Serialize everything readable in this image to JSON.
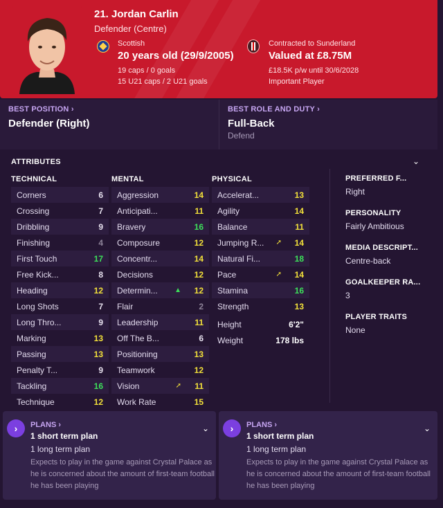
{
  "header": {
    "name": "21. Jordan Carlin",
    "position": "Defender (Centre)",
    "nationality": "Scottish",
    "age": "20 years old (29/9/2005)",
    "caps": "19 caps / 0 goals",
    "u21_caps": "15 U21 caps / 2 U21 goals",
    "contract": "Contracted to Sunderland",
    "value": "Valued at £8.75M",
    "wage": "£18.5K p/w until 30/6/2028",
    "importance": "Important Player",
    "colors": {
      "accent": "#c8192c"
    }
  },
  "best_position": {
    "title": "BEST POSITION",
    "value": "Defender (Right)"
  },
  "best_role": {
    "title": "BEST ROLE AND DUTY",
    "value": "Full-Back",
    "duty": "Defend"
  },
  "attributes": {
    "title": "ATTRIBUTES",
    "technical_title": "TECHNICAL",
    "mental_title": "MENTAL",
    "physical_title": "PHYSICAL",
    "technical": [
      {
        "name": "Corners",
        "value": "6"
      },
      {
        "name": "Crossing",
        "value": "7"
      },
      {
        "name": "Dribbling",
        "value": "9"
      },
      {
        "name": "Finishing",
        "value": "4"
      },
      {
        "name": "First Touch",
        "value": "17"
      },
      {
        "name": "Free Kick...",
        "value": "8"
      },
      {
        "name": "Heading",
        "value": "12"
      },
      {
        "name": "Long Shots",
        "value": "7"
      },
      {
        "name": "Long Thro...",
        "value": "9"
      },
      {
        "name": "Marking",
        "value": "13"
      },
      {
        "name": "Passing",
        "value": "13"
      },
      {
        "name": "Penalty T...",
        "value": "9"
      },
      {
        "name": "Tackling",
        "value": "16"
      },
      {
        "name": "Technique",
        "value": "12"
      }
    ],
    "mental": [
      {
        "name": "Aggression",
        "value": "14"
      },
      {
        "name": "Anticipati...",
        "value": "11"
      },
      {
        "name": "Bravery",
        "value": "16"
      },
      {
        "name": "Composure",
        "value": "12"
      },
      {
        "name": "Concentr...",
        "value": "14"
      },
      {
        "name": "Decisions",
        "value": "12"
      },
      {
        "name": "Determin...",
        "value": "12"
      },
      {
        "name": "Flair",
        "value": "2"
      },
      {
        "name": "Leadership",
        "value": "11"
      },
      {
        "name": "Off The B...",
        "value": "6"
      },
      {
        "name": "Positioning",
        "value": "13"
      },
      {
        "name": "Teamwork",
        "value": "12"
      },
      {
        "name": "Vision",
        "value": "11"
      },
      {
        "name": "Work Rate",
        "value": "15"
      }
    ],
    "physical": [
      {
        "name": "Accelerat...",
        "value": "13"
      },
      {
        "name": "Agility",
        "value": "14"
      },
      {
        "name": "Balance",
        "value": "11"
      },
      {
        "name": "Jumping R...",
        "value": "14"
      },
      {
        "name": "Natural Fi...",
        "value": "18"
      },
      {
        "name": "Pace",
        "value": "14"
      },
      {
        "name": "Stamina",
        "value": "16"
      },
      {
        "name": "Strength",
        "value": "13"
      }
    ],
    "height_label": "Height",
    "height": "6'2\"",
    "weight_label": "Weight",
    "weight": "178 lbs"
  },
  "side": {
    "preferred_foot_title": "PREFERRED F...",
    "preferred_foot": "Right",
    "personality_title": "PERSONALITY",
    "personality": "Fairly Ambitious",
    "media_title": "MEDIA DESCRIPT...",
    "media": "Centre-back",
    "gk_title": "GOALKEEPER RA...",
    "gk": "3",
    "traits_title": "PLAYER TRAITS",
    "traits": "None"
  },
  "plans": [
    {
      "title": "PLANS",
      "short": "1 short term plan",
      "long": "1 long term plan",
      "desc": "Expects to play in the game against Crystal Palace as he is concerned about the amount of first-team football he has been playing"
    },
    {
      "title": "PLANS",
      "short": "1 short term plan",
      "long": "1 long term plan",
      "desc": "Expects to play in the game against Crystal Palace as he is concerned about the amount of first-team football he has been playing"
    }
  ]
}
